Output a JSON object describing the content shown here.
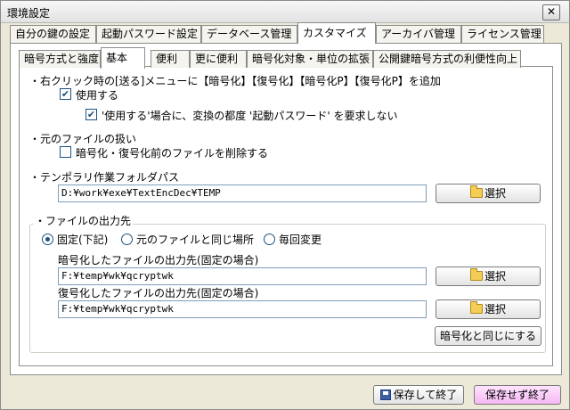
{
  "window": {
    "title": "環境設定",
    "close_label": "✕"
  },
  "outer_tabs": [
    "自分の鍵の設定",
    "起動パスワード設定",
    "データベース管理",
    "カスタマイズ",
    "アーカイバ管理",
    "ライセンス管理"
  ],
  "inner_tabs": [
    "暗号方式と強度",
    "基本",
    "便利",
    "更に便利",
    "暗号化対象・単位の拡張",
    "公開鍵暗号方式の利便性向上"
  ],
  "context_menu": {
    "heading": "・右クリック時の[送る]メニューに【暗号化】【復号化】【暗号化P】【復号化P】を追加",
    "use_label": "使用する",
    "use_checked": true,
    "ask_password_label": "'使用する'場合に、変換の都度 '起動パスワード' を要求しない",
    "ask_password_checked": true
  },
  "original_file": {
    "heading": "・元のファイルの扱い",
    "delete_label": "暗号化・復号化前のファイルを削除する",
    "delete_checked": false
  },
  "temp_folder": {
    "heading": "・テンポラリ作業フォルダパス",
    "value": "D:¥work¥exe¥TextEncDec¥TEMP",
    "select_label": "選択"
  },
  "output": {
    "heading": "・ファイルの出力先",
    "radio_fixed": "固定(下記)",
    "radio_same": "元のファイルと同じ場所",
    "radio_each": "毎回変更",
    "encrypt_label": "暗号化したファイルの出力先(固定の場合)",
    "encrypt_value": "F:¥temp¥wk¥qcryptwk",
    "decrypt_label": "復号化したファイルの出力先(固定の場合)",
    "decrypt_value": "F:¥temp¥wk¥qcryptwk",
    "select_label": "選択",
    "same_as_encrypt_label": "暗号化と同じにする"
  },
  "footer": {
    "save_close_label": "保存して終了",
    "close_no_save_label": "保存せず終了"
  }
}
